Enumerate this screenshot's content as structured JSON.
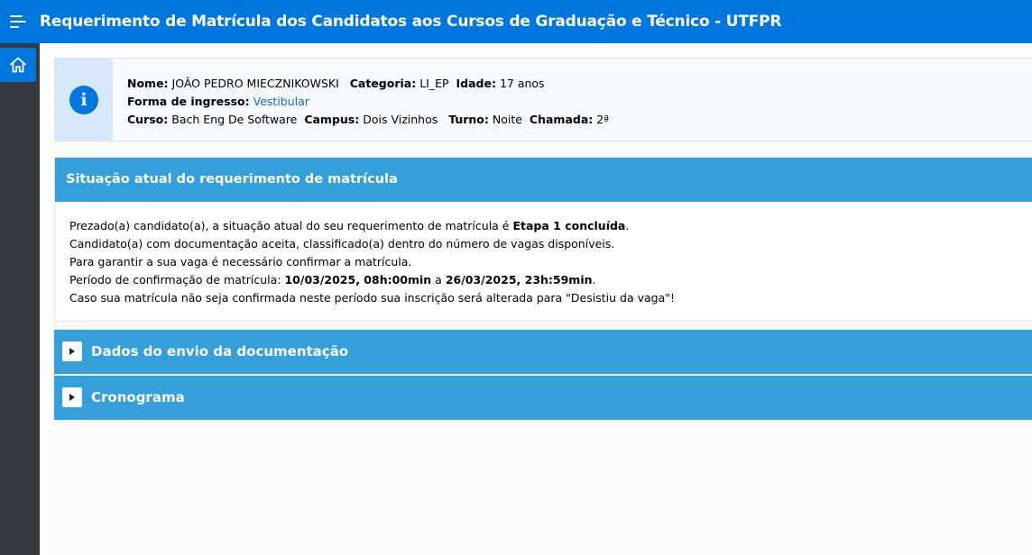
{
  "header": {
    "title": "Requerimento de Matrícula dos Candidatos aos Cursos de Graduação e Técnico - UTFPR"
  },
  "sidebar": {
    "home_icon": "home-icon"
  },
  "candidate": {
    "nome_label": "Nome:",
    "nome_value": "JOÃO PEDRO MIECZNIKOWSKI",
    "categoria_label": "Categoria:",
    "categoria_value": "LI_EP",
    "idade_label": "Idade:",
    "idade_value": "17 anos",
    "forma_label": "Forma de ingresso:",
    "forma_value": "Vestibular",
    "curso_label": "Curso:",
    "curso_value": "Bach Eng De Software",
    "campus_label": "Campus:",
    "campus_value": "Dois Vizinhos",
    "turno_label": "Turno:",
    "turno_value": "Noite",
    "chamada_label": "Chamada:",
    "chamada_value": "2ª"
  },
  "status": {
    "title": "Situação atual do requerimento de matrícula",
    "line1_prefix": "Prezado(a) candidato(a), a situação atual do seu requerimento de matrícula é ",
    "line1_status": "Etapa 1 concluída",
    "line1_suffix": ".",
    "line2": "Candidato(a) com documentação aceita, classificado(a) dentro do número de vagas disponíveis.",
    "line3": "Para garantir a sua vaga é necessário confirmar a matrícula.",
    "line4_prefix": "Período de confirmação de matrícula: ",
    "line4_start": "10/03/2025, 08h:00min",
    "line4_mid": " a ",
    "line4_end": "26/03/2025, 23h:59min",
    "line4_suffix": ".",
    "line5": "Caso sua matrícula não seja confirmada neste período sua inscrição será alterada para \"Desistiu da vaga\"!"
  },
  "accordions": [
    {
      "label": "Dados do envio da documentação"
    },
    {
      "label": "Cronograma"
    }
  ],
  "colors": {
    "header": "#0076df",
    "sidebar": "#343a40",
    "panel": "#359fdc"
  }
}
